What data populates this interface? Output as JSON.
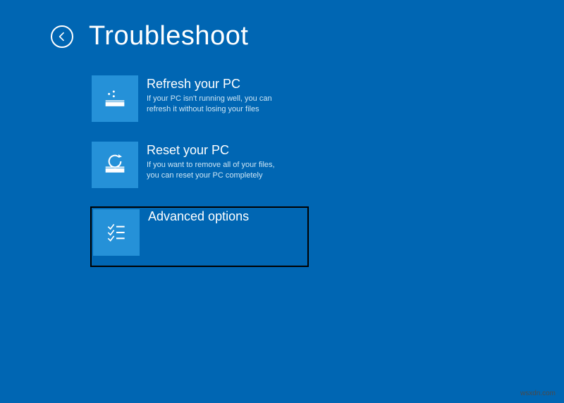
{
  "header": {
    "title": "Troubleshoot"
  },
  "options": {
    "refresh": {
      "title": "Refresh your PC",
      "desc": "If your PC isn't running well, you can refresh it without losing your files"
    },
    "reset": {
      "title": "Reset your PC",
      "desc": "If you want to remove all of your files, you can reset your PC completely"
    },
    "advanced": {
      "title": "Advanced options",
      "desc": ""
    }
  },
  "watermark": "wsxdn.com"
}
